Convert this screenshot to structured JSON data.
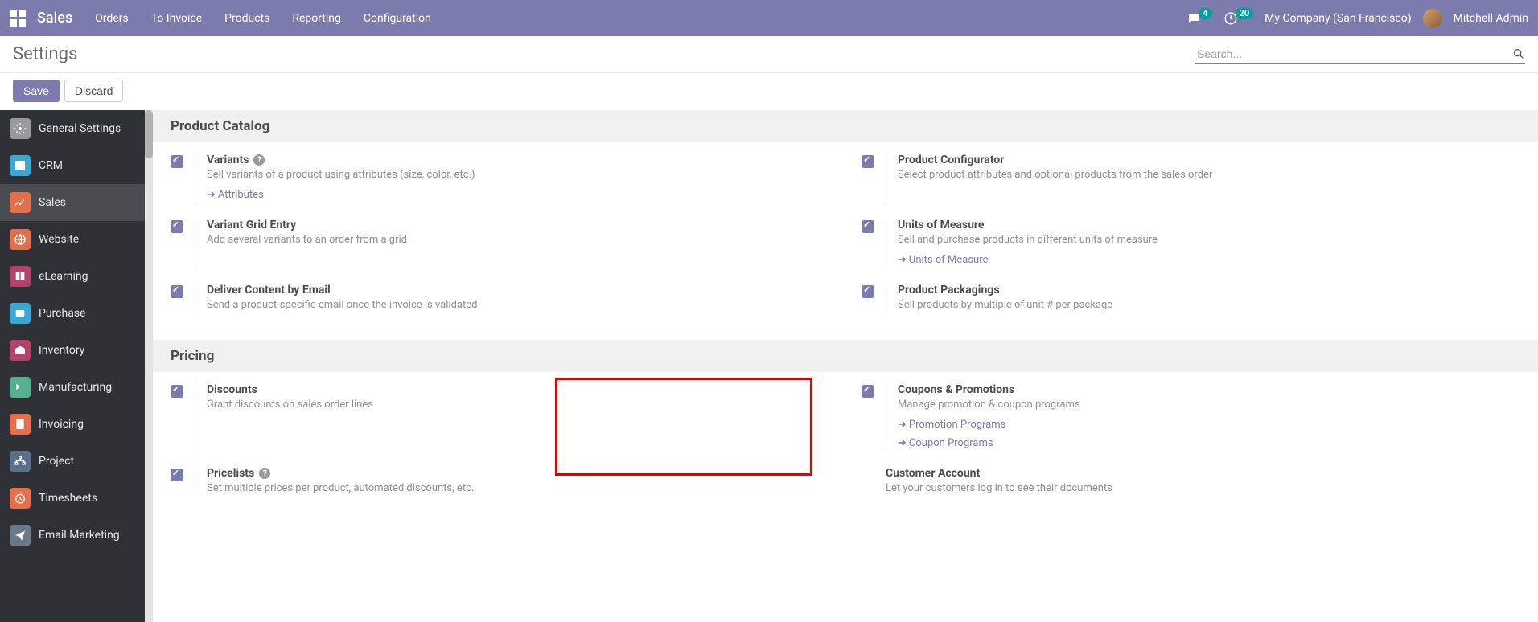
{
  "topnav": {
    "brand": "Sales",
    "menu": [
      "Orders",
      "To Invoice",
      "Products",
      "Reporting",
      "Configuration"
    ],
    "chat_badge": "4",
    "activity_badge": "20",
    "company": "My Company (San Francisco)",
    "user": "Mitchell Admin"
  },
  "subheader": {
    "title": "Settings",
    "search_placeholder": "Search..."
  },
  "actions": {
    "save": "Save",
    "discard": "Discard"
  },
  "sidebar": [
    {
      "label": "General Settings",
      "color": "#9a9a9a"
    },
    {
      "label": "CRM",
      "color": "#3aa7d4"
    },
    {
      "label": "Sales",
      "color": "#e46f4a",
      "active": true
    },
    {
      "label": "Website",
      "color": "#e46f4a"
    },
    {
      "label": "eLearning",
      "color": "#b5426a"
    },
    {
      "label": "Purchase",
      "color": "#3aa7d4"
    },
    {
      "label": "Inventory",
      "color": "#b5426a"
    },
    {
      "label": "Manufacturing",
      "color": "#54b08f"
    },
    {
      "label": "Invoicing",
      "color": "#e46f4a"
    },
    {
      "label": "Project",
      "color": "#5b6f8a"
    },
    {
      "label": "Timesheets",
      "color": "#e46f4a"
    },
    {
      "label": "Email Marketing",
      "color": "#6a7a8a"
    }
  ],
  "sections": {
    "product_catalog": {
      "title": "Product Catalog",
      "variants": {
        "title": "Variants",
        "desc": "Sell variants of a product using attributes (size, color, etc.)",
        "link": "Attributes",
        "help": true
      },
      "configurator": {
        "title": "Product Configurator",
        "desc": "Select product attributes and optional products from the sales order"
      },
      "grid": {
        "title": "Variant Grid Entry",
        "desc": "Add several variants to an order from a grid"
      },
      "uom": {
        "title": "Units of Measure",
        "desc": "Sell and purchase products in different units of measure",
        "link": "Units of Measure"
      },
      "deliver": {
        "title": "Deliver Content by Email",
        "desc": "Send a product-specific email once the invoice is validated"
      },
      "packaging": {
        "title": "Product Packagings",
        "desc": "Sell products by multiple of unit # per package"
      }
    },
    "pricing": {
      "title": "Pricing",
      "discounts": {
        "title": "Discounts",
        "desc": "Grant discounts on sales order lines"
      },
      "coupons": {
        "title": "Coupons & Promotions",
        "desc": "Manage promotion & coupon programs",
        "link1": "Promotion Programs",
        "link2": "Coupon Programs"
      },
      "pricelists": {
        "title": "Pricelists",
        "desc": "Set multiple prices per product, automated discounts, etc.",
        "help": true
      },
      "customer_account": {
        "title": "Customer Account",
        "desc": "Let your customers log in to see their documents"
      }
    }
  }
}
